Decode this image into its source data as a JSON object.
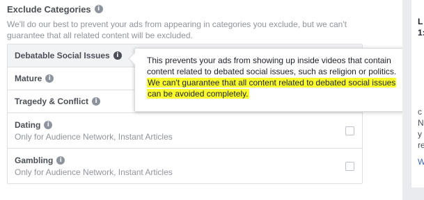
{
  "section": {
    "title": "Exclude Categories",
    "info_icon": "info-icon",
    "description": "We'll do our best to prevent your ads from appearing in categories you exclude, but we can't guarantee that all related content will be excluded."
  },
  "categories": [
    {
      "label": "Debatable Social Issues",
      "sublabel": "",
      "icon": "info-icon"
    },
    {
      "label": "Mature",
      "sublabel": "",
      "icon": "info-icon"
    },
    {
      "label": "Tragedy & Conflict",
      "sublabel": "",
      "icon": "info-icon"
    },
    {
      "label": "Dating",
      "sublabel": "Only for Audience Network, Instant Articles",
      "icon": "info-icon"
    },
    {
      "label": "Gambling",
      "sublabel": "Only for Audience Network, Instant Articles",
      "icon": "info-icon"
    }
  ],
  "tooltip": {
    "text": "This prevents your ads from showing up inside videos that contain content related to debated social issues, such as religion or politics.",
    "highlighted_text": "We can't guarantee that all content related to debated social issues can be avoided completely.",
    "highlight_color": "#fbff2e"
  },
  "right_panel": {
    "lines": [
      "L",
      "1:",
      "c",
      "N",
      "y",
      "re",
      "W"
    ]
  }
}
